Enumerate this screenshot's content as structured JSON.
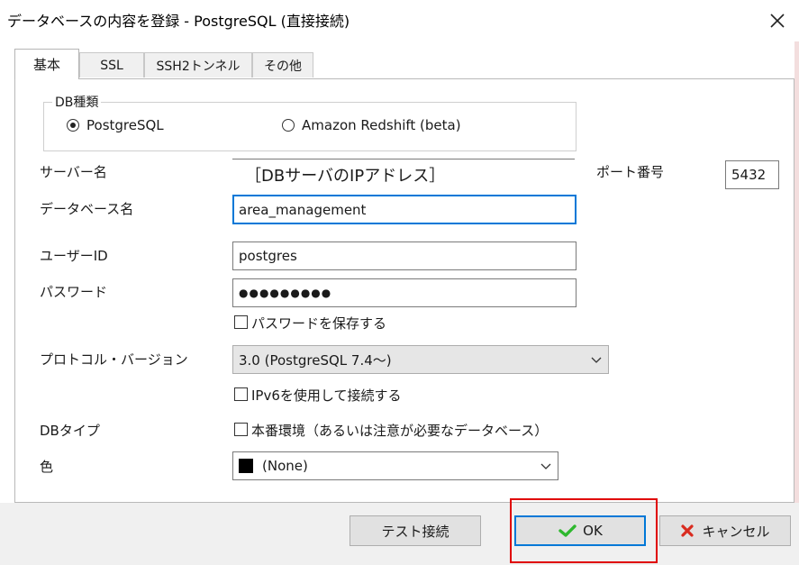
{
  "window": {
    "title": "データベースの内容を登録 - PostgreSQL (直接接続)",
    "close_icon": "close-icon"
  },
  "tabs": [
    {
      "label": "基本",
      "active": true
    },
    {
      "label": "SSL",
      "active": false
    },
    {
      "label": "SSH2トンネル",
      "active": false
    },
    {
      "label": "その他",
      "active": false
    }
  ],
  "db_type_group": {
    "label": "DB種類",
    "options": [
      {
        "label": "PostgreSQL",
        "selected": true
      },
      {
        "label": "Amazon Redshift (beta)",
        "selected": false
      }
    ]
  },
  "form": {
    "server_label": "サーバー名",
    "server_value": "［DBサーバのIPアドレス］",
    "port_label": "ポート番号",
    "port_value": "5432",
    "database_label": "データベース名",
    "database_value": "area_management",
    "user_label": "ユーザーID",
    "user_value": "postgres",
    "password_label": "パスワード",
    "password_value": "●●●●●●●●●",
    "save_password_label": "パスワードを保存する",
    "protocol_label": "プロトコル・バージョン",
    "protocol_value": "3.0  (PostgreSQL 7.4〜)",
    "ipv6_label": "IPv6を使用して接続する",
    "dbtype_label": "DBタイプ",
    "production_label": "本番環境（あるいは注意が必要なデータベース）",
    "color_label": "色",
    "color_value": "(None)",
    "color_swatch": "#000000"
  },
  "footer": {
    "test_connection": "テスト接続",
    "ok": "OK",
    "ok_icon": "check-icon",
    "ok_icon_color": "#2eb82e",
    "cancel": "キャンセル",
    "cancel_icon": "x-icon",
    "cancel_icon_color": "#d92b1f"
  },
  "colors": {
    "focus_border": "#0078d7",
    "highlight_border": "#e00000"
  }
}
